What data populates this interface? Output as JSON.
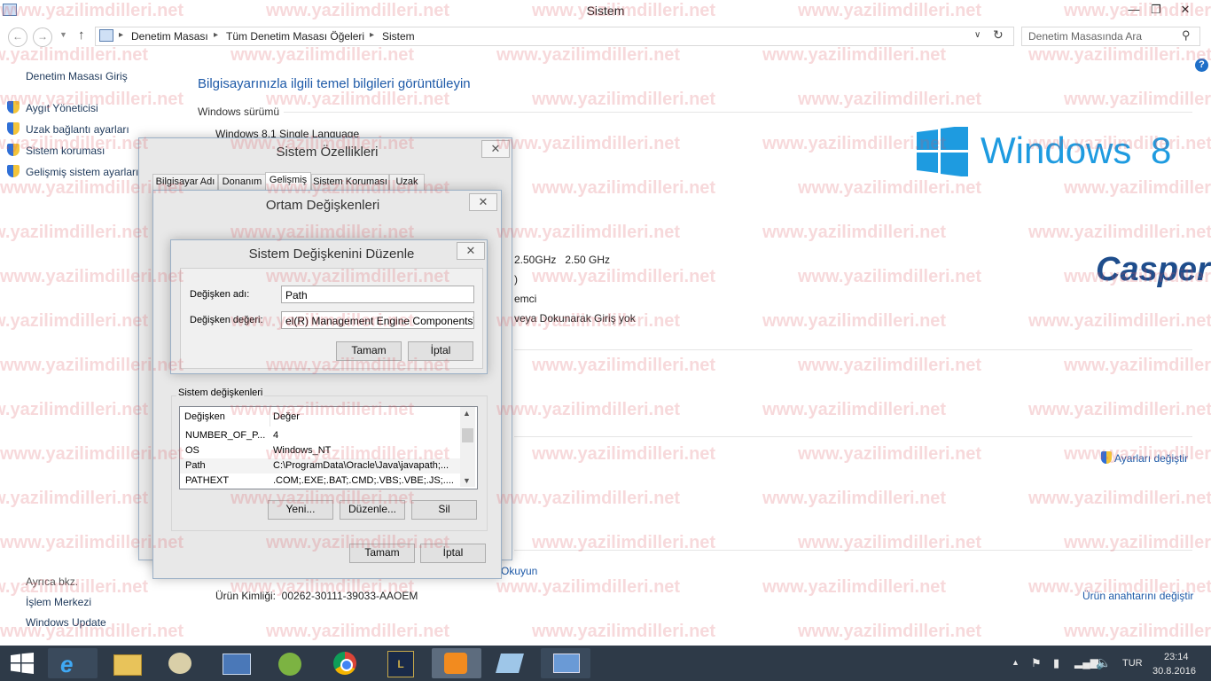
{
  "window": {
    "title": "Sistem"
  },
  "address": {
    "crumbs": [
      "Denetim Masası",
      "Tüm Denetim Masası Öğeleri",
      "Sistem"
    ],
    "search_placeholder": "Denetim Masasında Ara"
  },
  "sidebar": {
    "home": "Denetim Masası Giriş",
    "items": [
      {
        "label": "Aygıt Yöneticisi"
      },
      {
        "label": "Uzak bağlantı ayarları"
      },
      {
        "label": "Sistem koruması"
      },
      {
        "label": "Gelişmiş sistem ayarları"
      }
    ],
    "see_also": "Ayrıca bkz.",
    "see_also_items": [
      "İşlem Merkezi",
      "Windows Update"
    ]
  },
  "main": {
    "heading": "Bilgisayarınızla ilgili temel bilgileri görüntüleyin",
    "edition_label": "Windows sürümü",
    "edition_value": "Windows 8.1 Single Language",
    "processor_fragment": "2.50GHz   2.50 GHz",
    "fragment_paren": ")",
    "fragment_emci": "emci",
    "fragment_touch": "veya Dokunarak Giriş yok",
    "change_settings": "Ayarları değiştir",
    "read_link": "Okuyun",
    "product_id": "Ürün Kimliği:  00262-30111-39033-AAOEM",
    "change_key": "Ürün anahtarını değiştir",
    "windows_logo_text": "Windows",
    "windows_logo_num": "8",
    "oem_logo": "Casper"
  },
  "dlg_system": {
    "title": "Sistem Özellikleri",
    "tabs": [
      "Bilgisayar Adı",
      "Donanım",
      "Gelişmiş",
      "Sistem Koruması",
      "Uzak"
    ],
    "active_tab": "Gelişmiş"
  },
  "dlg_env": {
    "title": "Ortam Değişkenleri",
    "sys_vars_label": "Sistem değişkenleri",
    "columns": [
      "Değişken",
      "Değer"
    ],
    "rows": [
      {
        "name": "NUMBER_OF_P...",
        "value": "4"
      },
      {
        "name": "OS",
        "value": "Windows_NT"
      },
      {
        "name": "Path",
        "value": "C:\\ProgramData\\Oracle\\Java\\javapath;..."
      },
      {
        "name": "PATHEXT",
        "value": ".COM;.EXE;.BAT;.CMD;.VBS;.VBE;.JS;...."
      }
    ],
    "new_btn": "Yeni...",
    "edit_btn": "Düzenle...",
    "delete_btn": "Sil",
    "ok_btn": "Tamam",
    "cancel_btn": "İptal"
  },
  "dlg_edit": {
    "title": "Sistem Değişkenini Düzenle",
    "name_label": "Değişken adı:",
    "name_value": "Path",
    "value_label": "Değişken değeri:",
    "value_value": "el(R) Management Engine Components\\IPT",
    "ok_btn": "Tamam",
    "cancel_btn": "İptal"
  },
  "taskbar": {
    "lang": "TUR",
    "time": "23:14",
    "date": "30.8.2016"
  },
  "watermark": "www.yazilimdilleri.net",
  "colors": {
    "link": "#1e5aa8",
    "taskbar": "#2e3a48",
    "win8_blue": "#1e9be0",
    "casper_blue": "#1e4d8c"
  }
}
